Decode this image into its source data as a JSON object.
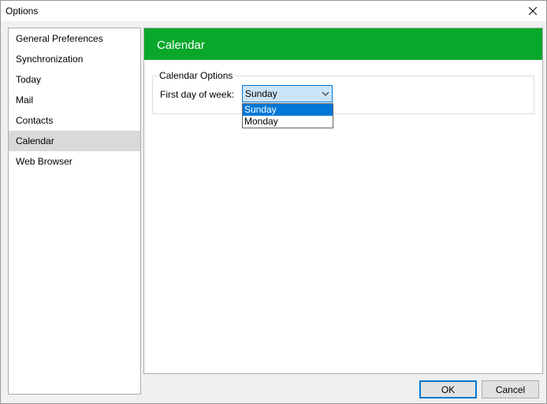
{
  "window": {
    "title": "Options"
  },
  "sidebar": {
    "items": [
      {
        "label": "General Preferences"
      },
      {
        "label": "Synchronization"
      },
      {
        "label": "Today"
      },
      {
        "label": "Mail"
      },
      {
        "label": "Contacts"
      },
      {
        "label": "Calendar",
        "selected": true
      },
      {
        "label": "Web Browser"
      }
    ]
  },
  "content": {
    "header": "Calendar",
    "header_color": "#09a82b",
    "group": {
      "legend": "Calendar Options",
      "first_day_label": "First day of week:",
      "first_day_value": "Sunday",
      "options": [
        "Sunday",
        "Monday"
      ]
    }
  },
  "buttons": {
    "ok": "OK",
    "cancel": "Cancel"
  }
}
